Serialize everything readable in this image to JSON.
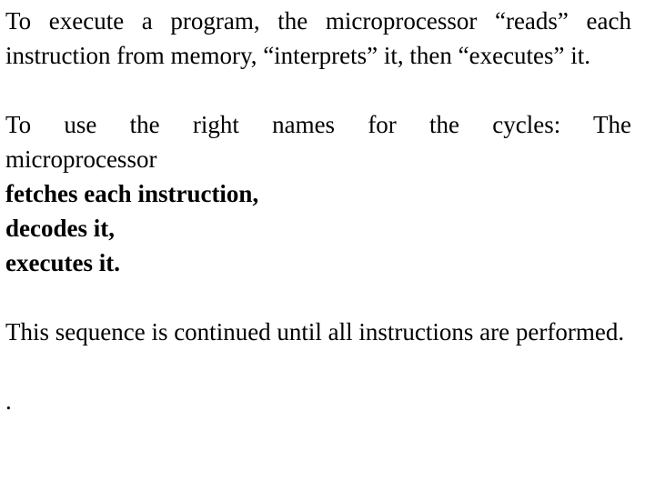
{
  "slide": {
    "background_color": "#ffffff",
    "text_color": "#000000",
    "blocks": {
      "para1": "To execute a program, the microprocessor “reads” each instruction from memory, “interprets” it, then “executes” it.",
      "para2_intro_line": "To use the right names for the cycles: The",
      "para2_intro_cont": "microprocessor",
      "step1": "fetches each instruction,",
      "step2": "decodes it,",
      "step3": "executes it.",
      "para3": "This sequence is continued until all instructions are performed.",
      "trailing_mark": "."
    }
  }
}
